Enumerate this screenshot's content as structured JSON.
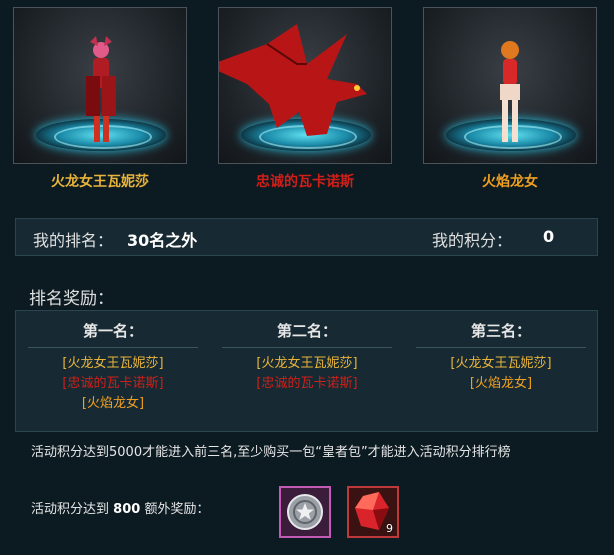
{
  "characters": [
    {
      "name": "火龙女王瓦妮莎",
      "color": "#e8b43a"
    },
    {
      "name": "忠诚的瓦卡诺斯",
      "color": "#d01f18"
    },
    {
      "name": "火焰龙女",
      "color": "#f0a020"
    }
  ],
  "ranking": {
    "my_rank_label": "我的排名：",
    "my_rank_value": "30名之外",
    "my_score_label": "我的积分：",
    "my_score_value": "0"
  },
  "rewards": {
    "title": "排名奖励：",
    "tiers": [
      {
        "heading": "第一名：",
        "items": [
          "[火龙女王瓦妮莎]",
          "[忠诚的瓦卡诺斯]",
          "[火焰龙女]"
        ]
      },
      {
        "heading": "第二名：",
        "items": [
          "[火龙女王瓦妮莎]",
          "[忠诚的瓦卡诺斯]"
        ]
      },
      {
        "heading": "第三名：",
        "items": [
          "[火龙女王瓦妮莎]",
          "[火焰龙女]"
        ]
      }
    ]
  },
  "notice": "活动积分达到5000才能进入前三名,至少购买一包“皇者包”才能进入活动积分排行榜",
  "extra_reward": {
    "prefix": "活动积分达到",
    "threshold": "800",
    "suffix": "额外奖励：",
    "items": [
      {
        "icon": "silver-coin-icon",
        "count": ""
      },
      {
        "icon": "red-crystal-icon",
        "count": "9"
      }
    ]
  }
}
